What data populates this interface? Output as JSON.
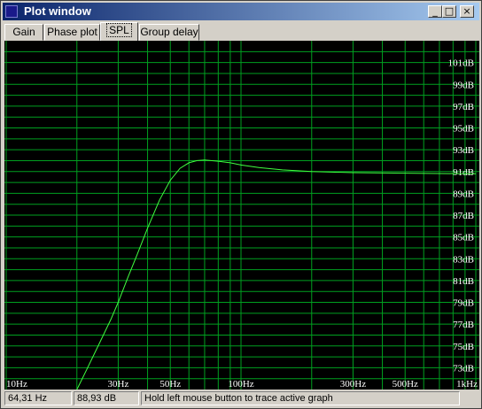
{
  "window": {
    "title": "Plot window"
  },
  "tabs": [
    {
      "label": "Gain"
    },
    {
      "label": "Phase plot"
    },
    {
      "label": "SPL",
      "active": true
    },
    {
      "label": "Group delay"
    }
  ],
  "colors": {
    "grid": "#00a020",
    "curve": "#40ff40",
    "plot_bg": "#000000",
    "titlebar_start": "#0a246a",
    "titlebar_end": "#a6caf0"
  },
  "chart_data": {
    "type": "line",
    "x_scale": "log",
    "x_range": [
      10,
      1000
    ],
    "y_range": [
      71,
      103
    ],
    "x_ticks": [
      {
        "value": 10,
        "label": "10Hz"
      },
      {
        "value": 30,
        "label": "30Hz"
      },
      {
        "value": 50,
        "label": "50Hz"
      },
      {
        "value": 100,
        "label": "100Hz"
      },
      {
        "value": 300,
        "label": "300Hz"
      },
      {
        "value": 500,
        "label": "500Hz"
      },
      {
        "value": 1000,
        "label": "1kHz"
      }
    ],
    "y_ticks": [
      {
        "value": 101,
        "label": "101dB"
      },
      {
        "value": 99,
        "label": "99dB"
      },
      {
        "value": 97,
        "label": "97dB"
      },
      {
        "value": 95,
        "label": "95dB"
      },
      {
        "value": 93,
        "label": "93dB"
      },
      {
        "value": 91,
        "label": "91dB"
      },
      {
        "value": 89,
        "label": "89dB"
      },
      {
        "value": 87,
        "label": "87dB"
      },
      {
        "value": 85,
        "label": "85dB"
      },
      {
        "value": 83,
        "label": "83dB"
      },
      {
        "value": 81,
        "label": "81dB"
      },
      {
        "value": 79,
        "label": "79dB"
      },
      {
        "value": 77,
        "label": "77dB"
      },
      {
        "value": 75,
        "label": "75dB"
      },
      {
        "value": 73,
        "label": "73dB"
      }
    ],
    "grid": true,
    "series": [
      {
        "x": [
          20,
          22,
          25,
          28,
          30,
          33,
          36,
          40,
          45,
          50,
          55,
          60,
          65,
          70,
          80,
          90,
          100,
          120,
          150,
          200,
          300,
          500,
          700,
          1000
        ],
        "y": [
          71.0,
          72.8,
          75.3,
          77.5,
          79.0,
          81.3,
          83.3,
          85.8,
          88.4,
          90.2,
          91.3,
          91.8,
          92.0,
          92.05,
          91.95,
          91.8,
          91.6,
          91.35,
          91.15,
          91.0,
          90.9,
          90.85,
          90.82,
          90.8
        ]
      }
    ]
  },
  "status": {
    "frequency": "64,31 Hz",
    "level": "88,93 dB",
    "hint": "Hold left mouse button to trace active graph"
  }
}
